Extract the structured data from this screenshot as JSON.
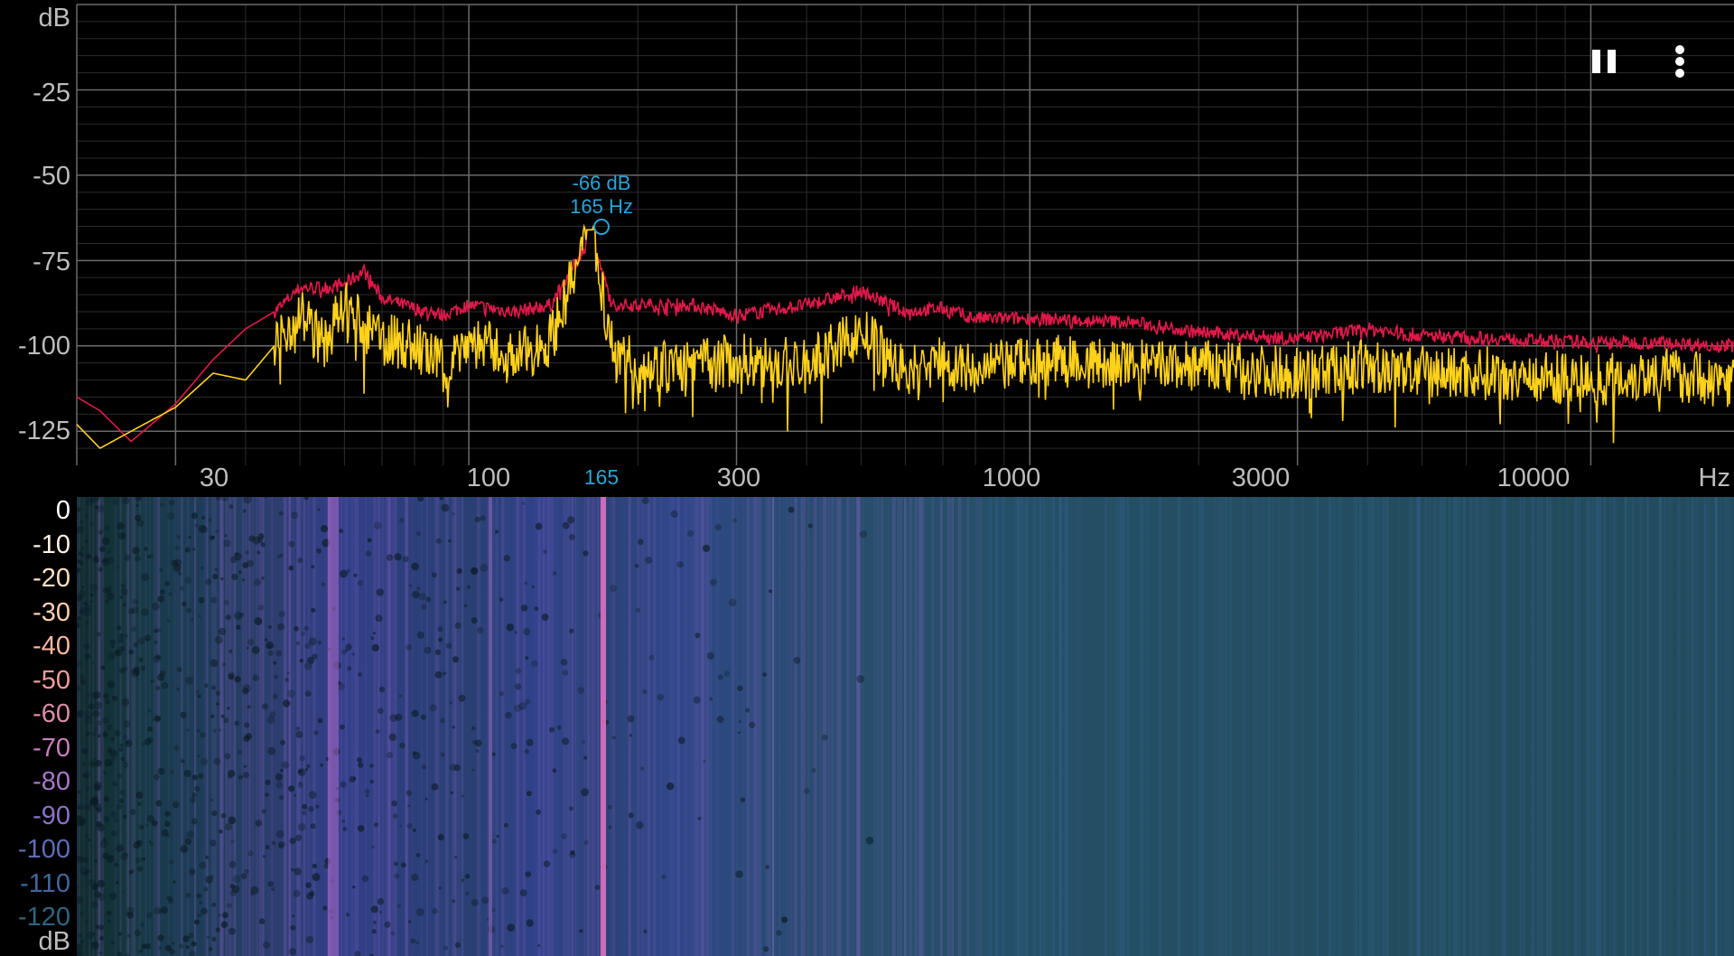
{
  "toolbar": {
    "pause_icon": "pause-icon",
    "menu_icon": "more-vert-icon"
  },
  "spectrum": {
    "y_unit": "dB",
    "y_ticks": [
      "-25",
      "-50",
      "-75",
      "-100",
      "-125"
    ],
    "x_unit": "Hz",
    "x_ticks": [
      "30",
      "100",
      "300",
      "1000",
      "3000",
      "10000"
    ],
    "peak": {
      "db_label": "-66 dB",
      "hz_label": "165 Hz",
      "axis_marker": "165"
    },
    "colors": {
      "peak_hold": "#e0194a",
      "live": "#ffd21a",
      "grid": "#5a5a5a",
      "peak_marker": "#2aa3d6"
    }
  },
  "spectrogram": {
    "scale_ticks": [
      "0",
      "-10",
      "-20",
      "-30",
      "-40",
      "-50",
      "-60",
      "-70",
      "-80",
      "-90",
      "-100",
      "-110",
      "-120"
    ],
    "scale_colors": [
      "#ffffff",
      "#fff3e6",
      "#ffe0c8",
      "#ffcfb0",
      "#f8b79e",
      "#f09c9c",
      "#e08aaa",
      "#c77fbc",
      "#a878c8",
      "#8a72c8",
      "#5f6cb6",
      "#41679c",
      "#2e6580"
    ],
    "unit": "dB"
  },
  "chart_data": {
    "type": "line",
    "xlabel": "Hz",
    "ylabel": "dB",
    "xscale": "log",
    "xlim": [
      20,
      18000
    ],
    "ylim": [
      -135,
      0
    ],
    "series": [
      {
        "x": [
          20,
          22,
          25,
          30,
          35,
          40,
          45,
          50,
          55,
          60,
          65,
          70,
          80,
          90,
          100,
          120,
          140,
          165,
          180,
          200,
          250,
          300,
          400,
          500,
          600,
          700,
          800,
          1000,
          1500,
          2000,
          3000,
          4000,
          5000,
          7000,
          10000,
          13000,
          18000
        ],
        "y": [
          -115,
          -119,
          -128,
          -117,
          -104,
          -95,
          -90,
          -83,
          -83,
          -82,
          -78,
          -86,
          -89,
          -91,
          -88,
          -90,
          -88,
          -68,
          -88,
          -88,
          -88,
          -91,
          -88,
          -84,
          -90,
          -89,
          -92,
          -92,
          -93,
          -96,
          -98,
          -95,
          -97,
          -98,
          -99,
          -99,
          -100
        ]
      },
      {
        "x": [
          20,
          22,
          25,
          30,
          35,
          40,
          45,
          50,
          55,
          60,
          65,
          70,
          80,
          90,
          100,
          120,
          140,
          165,
          180,
          200,
          250,
          300,
          400,
          500,
          600,
          700,
          800,
          1000,
          1500,
          2000,
          3000,
          4000,
          5000,
          7000,
          10000,
          13000,
          18000
        ],
        "y": [
          -123,
          -130,
          -125,
          -118,
          -108,
          -110,
          -100,
          -90,
          -100,
          -88,
          -95,
          -98,
          -100,
          -106,
          -98,
          -104,
          -98,
          -66,
          -100,
          -106,
          -106,
          -104,
          -106,
          -96,
          -108,
          -104,
          -108,
          -104,
          -106,
          -106,
          -108,
          -106,
          -108,
          -108,
          -110,
          -108,
          -110
        ]
      }
    ]
  }
}
